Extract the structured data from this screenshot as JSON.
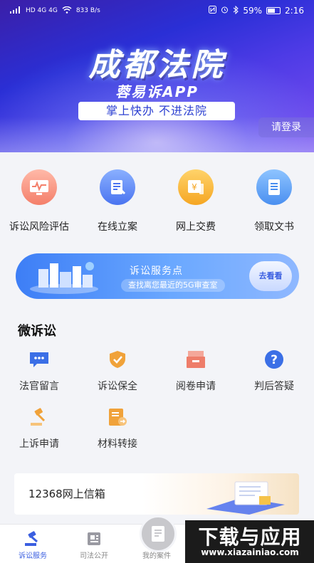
{
  "status_bar": {
    "network": "HD 4G 4G",
    "speed": "833 B/s",
    "battery": "59%",
    "time": "2:16"
  },
  "banner": {
    "title": "成都法院",
    "subtitle": "蓉易诉APP",
    "slogan": "掌上快办  不进法院",
    "login": "请登录"
  },
  "quick_actions": [
    {
      "label": "诉讼风险评估",
      "icon": "risk-assessment-icon"
    },
    {
      "label": "在线立案",
      "icon": "online-filing-icon"
    },
    {
      "label": "网上交费",
      "icon": "payment-icon"
    },
    {
      "label": "领取文书",
      "icon": "document-icon"
    }
  ],
  "service_card": {
    "title": "诉讼服务点",
    "subtitle": "查找离您最近的5G审查室",
    "button": "去看看"
  },
  "micro": {
    "title": "微诉讼",
    "items": [
      {
        "label": "法官留言",
        "icon": "message-icon"
      },
      {
        "label": "诉讼保全",
        "icon": "shield-check-icon"
      },
      {
        "label": "阅卷申请",
        "icon": "case-file-icon"
      },
      {
        "label": "判后答疑",
        "icon": "question-icon"
      },
      {
        "label": "上诉申请",
        "icon": "gavel-icon"
      },
      {
        "label": "材料转接",
        "icon": "material-transfer-icon"
      }
    ]
  },
  "mailbox": {
    "label": "12368网上信箱"
  },
  "tabbar": {
    "tabs": [
      {
        "label": "诉讼服务",
        "active": true
      },
      {
        "label": "司法公开",
        "active": false
      },
      {
        "label": "我的案件",
        "active": false
      }
    ]
  },
  "watermark": {
    "text": "下载与应用",
    "url": "www.xiazainiao.com"
  },
  "colors": {
    "accent": "#3b5fe0",
    "banner": "#3b1fa8",
    "orange": "#f0a23a"
  }
}
